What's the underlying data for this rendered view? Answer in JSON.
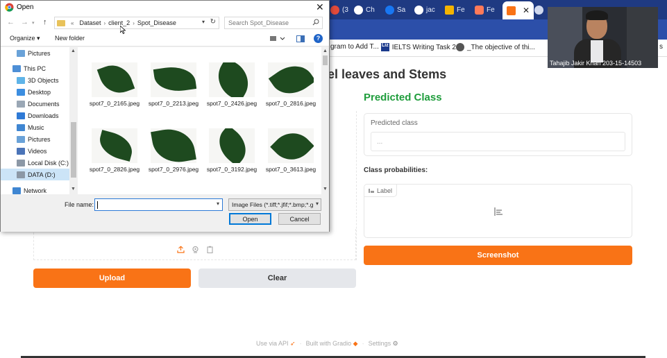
{
  "browser": {
    "tabs": [
      {
        "label": "(3",
        "icon": "red-notification-icon",
        "color": "#e24b3b"
      },
      {
        "label": "Ch",
        "icon": "chatgpt-icon",
        "color": "#ffffff"
      },
      {
        "label": "Sa",
        "icon": "facebook-icon",
        "color": "#1877f2"
      },
      {
        "label": "jac",
        "icon": "google-icon",
        "color": "#ffffff"
      },
      {
        "label": "Fe",
        "icon": "google-drive-icon",
        "color": "#f4b400"
      },
      {
        "label": "Fe",
        "icon": "infinity-icon",
        "color": "#ff7a59"
      },
      {
        "label": "",
        "icon": "gradio-icon",
        "color": "#f97316",
        "active": true,
        "close": "✕"
      },
      {
        "label": "",
        "icon": "globe-icon",
        "color": "#cfd8ee"
      }
    ],
    "bookmarks": [
      {
        "label": "gram to Add T...",
        "icon": "bookmark-page-icon"
      },
      {
        "label": "IELTS Writing Task 2:...",
        "badge": "Liz",
        "icon": "liz-icon"
      },
      {
        "label": "_The objective of thi...",
        "icon": "globe-icon"
      }
    ],
    "extra_bookmark": "s"
  },
  "gradio": {
    "heading": "tel leaves and Stems",
    "predicted_section_title": "Predicted Class",
    "predicted_label": "Predicted class",
    "predicted_placeholder": "...",
    "probs_title": "Class probabilities:",
    "label_chip": "Label",
    "screenshot_button": "Screenshot",
    "upload_button": "Upload",
    "clear_button": "Clear",
    "footer": {
      "api": "Use via API",
      "built": "Built with Gradio",
      "settings": "Settings",
      "sep": "·"
    },
    "colors": {
      "accent": "#f97316",
      "title_green": "#1f9d3c"
    }
  },
  "webcam": {
    "name": "Tahajib Jakir Khan 203-15-14503"
  },
  "dialog": {
    "title": "Open",
    "close": "✕",
    "path": [
      "«",
      "Dataset",
      "›",
      "client_2",
      "›",
      "Spot_Disease"
    ],
    "search_placeholder": "Search Spot_Disease",
    "toolbar": {
      "organize": "Organize ▾",
      "new_folder": "New folder",
      "help": "?"
    },
    "nav_items": [
      {
        "label": "Pictures",
        "icon": "pictures-icon",
        "indent": 1
      },
      {
        "label": "This PC",
        "icon": "this-pc-icon",
        "indent": 0
      },
      {
        "label": "3D Objects",
        "icon": "3d-objects-icon",
        "indent": 1
      },
      {
        "label": "Desktop",
        "icon": "desktop-icon",
        "indent": 1
      },
      {
        "label": "Documents",
        "icon": "documents-icon",
        "indent": 1
      },
      {
        "label": "Downloads",
        "icon": "downloads-icon",
        "indent": 1
      },
      {
        "label": "Music",
        "icon": "music-icon",
        "indent": 1
      },
      {
        "label": "Pictures",
        "icon": "pictures-icon",
        "indent": 1
      },
      {
        "label": "Videos",
        "icon": "videos-icon",
        "indent": 1
      },
      {
        "label": "Local Disk (C:)",
        "icon": "local-disk-icon",
        "indent": 1
      },
      {
        "label": "DATA (D:)",
        "icon": "drive-icon",
        "indent": 1,
        "selected": true
      },
      {
        "label": "Network",
        "icon": "network-icon",
        "indent": 0
      }
    ],
    "files": [
      "spot7_0_2165.jpeg",
      "spot7_0_2213.jpeg",
      "spot7_0_2426.jpeg",
      "spot7_0_2816.jpeg",
      "spot7_0_2826.jpeg",
      "spot7_0_2976.jpeg",
      "spot7_0_3192.jpeg",
      "spot7_0_3613.jpeg"
    ],
    "file_name_label": "File name:",
    "file_name_value": "",
    "file_type": "Image Files (*.tiff;*.jfif;*.bmp;*.g",
    "open_button": "Open",
    "cancel_button": "Cancel"
  }
}
